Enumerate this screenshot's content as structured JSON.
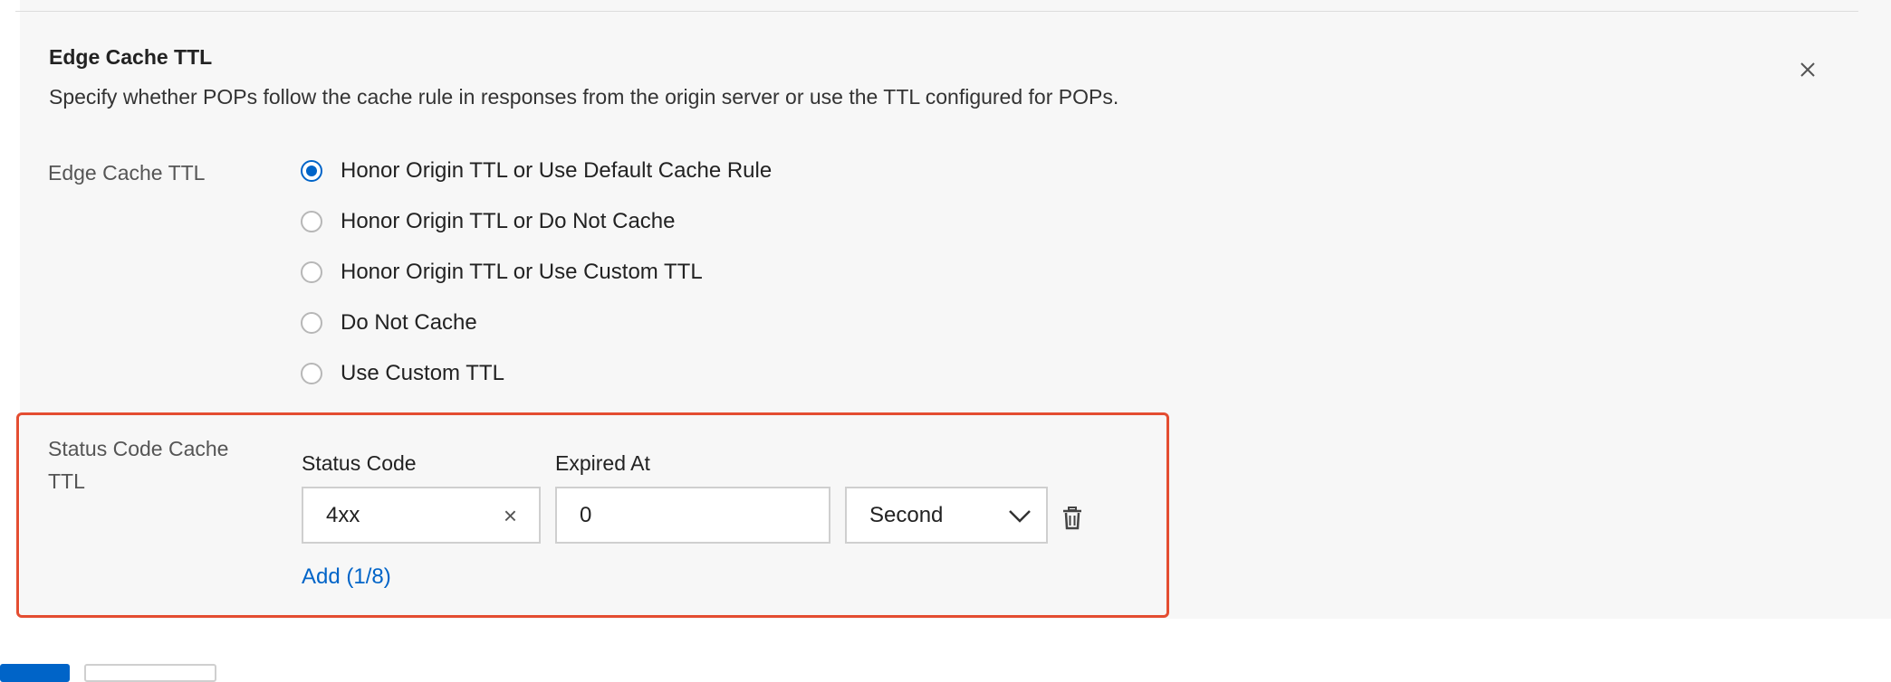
{
  "section": {
    "title": "Edge Cache TTL",
    "description": "Specify whether POPs follow the cache rule in responses from the origin server or use the TTL configured for POPs."
  },
  "edge_cache_ttl": {
    "label": "Edge Cache TTL",
    "options": [
      {
        "label": "Honor Origin TTL or Use Default Cache Rule",
        "checked": true
      },
      {
        "label": "Honor Origin TTL or Do Not Cache",
        "checked": false
      },
      {
        "label": "Honor Origin TTL or Use Custom TTL",
        "checked": false
      },
      {
        "label": "Do Not Cache",
        "checked": false
      },
      {
        "label": "Use Custom TTL",
        "checked": false
      }
    ]
  },
  "status_code_cache_ttl": {
    "label_line1": "Status Code Cache",
    "label_line2": "TTL",
    "status_code_header": "Status Code",
    "expired_at_header": "Expired At",
    "status_code_value": "4xx",
    "clear_glyph": "×",
    "expired_at_value": "0",
    "unit_value": "Second",
    "add_link": "Add (1/8)"
  },
  "colors": {
    "accent": "#0064c8",
    "highlight_border": "#e44d31",
    "panel_bg": "#f7f7f7"
  },
  "icons": {
    "close": "close-icon",
    "dropdown": "chevron-down-icon",
    "delete": "trash-icon"
  }
}
